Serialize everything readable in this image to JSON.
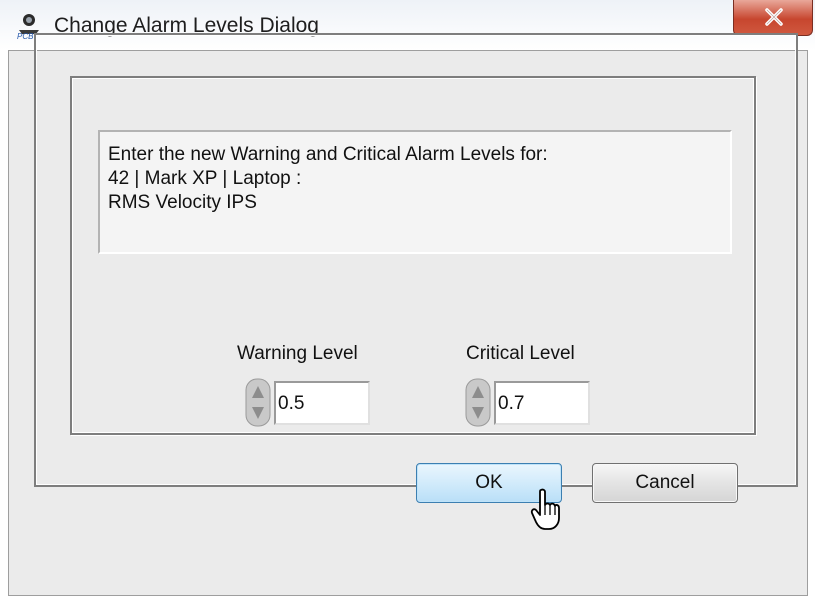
{
  "window": {
    "title": "Change Alarm Levels Dialog",
    "icon": "app-logo-icon",
    "close_icon": "close-x-icon"
  },
  "message": {
    "line1": "Enter the new Warning and Critical Alarm Levels for:",
    "line2": " 42 | Mark XP | Laptop :",
    "line3": " RMS Velocity IPS"
  },
  "warning": {
    "label": "Warning Level",
    "value": "0.5"
  },
  "critical": {
    "label": "Critical Level",
    "value": "0.7"
  },
  "buttons": {
    "ok": "OK",
    "cancel": "Cancel"
  },
  "colors": {
    "close_button": "#c7462f",
    "ok_button_border": "#3c7fb1"
  }
}
